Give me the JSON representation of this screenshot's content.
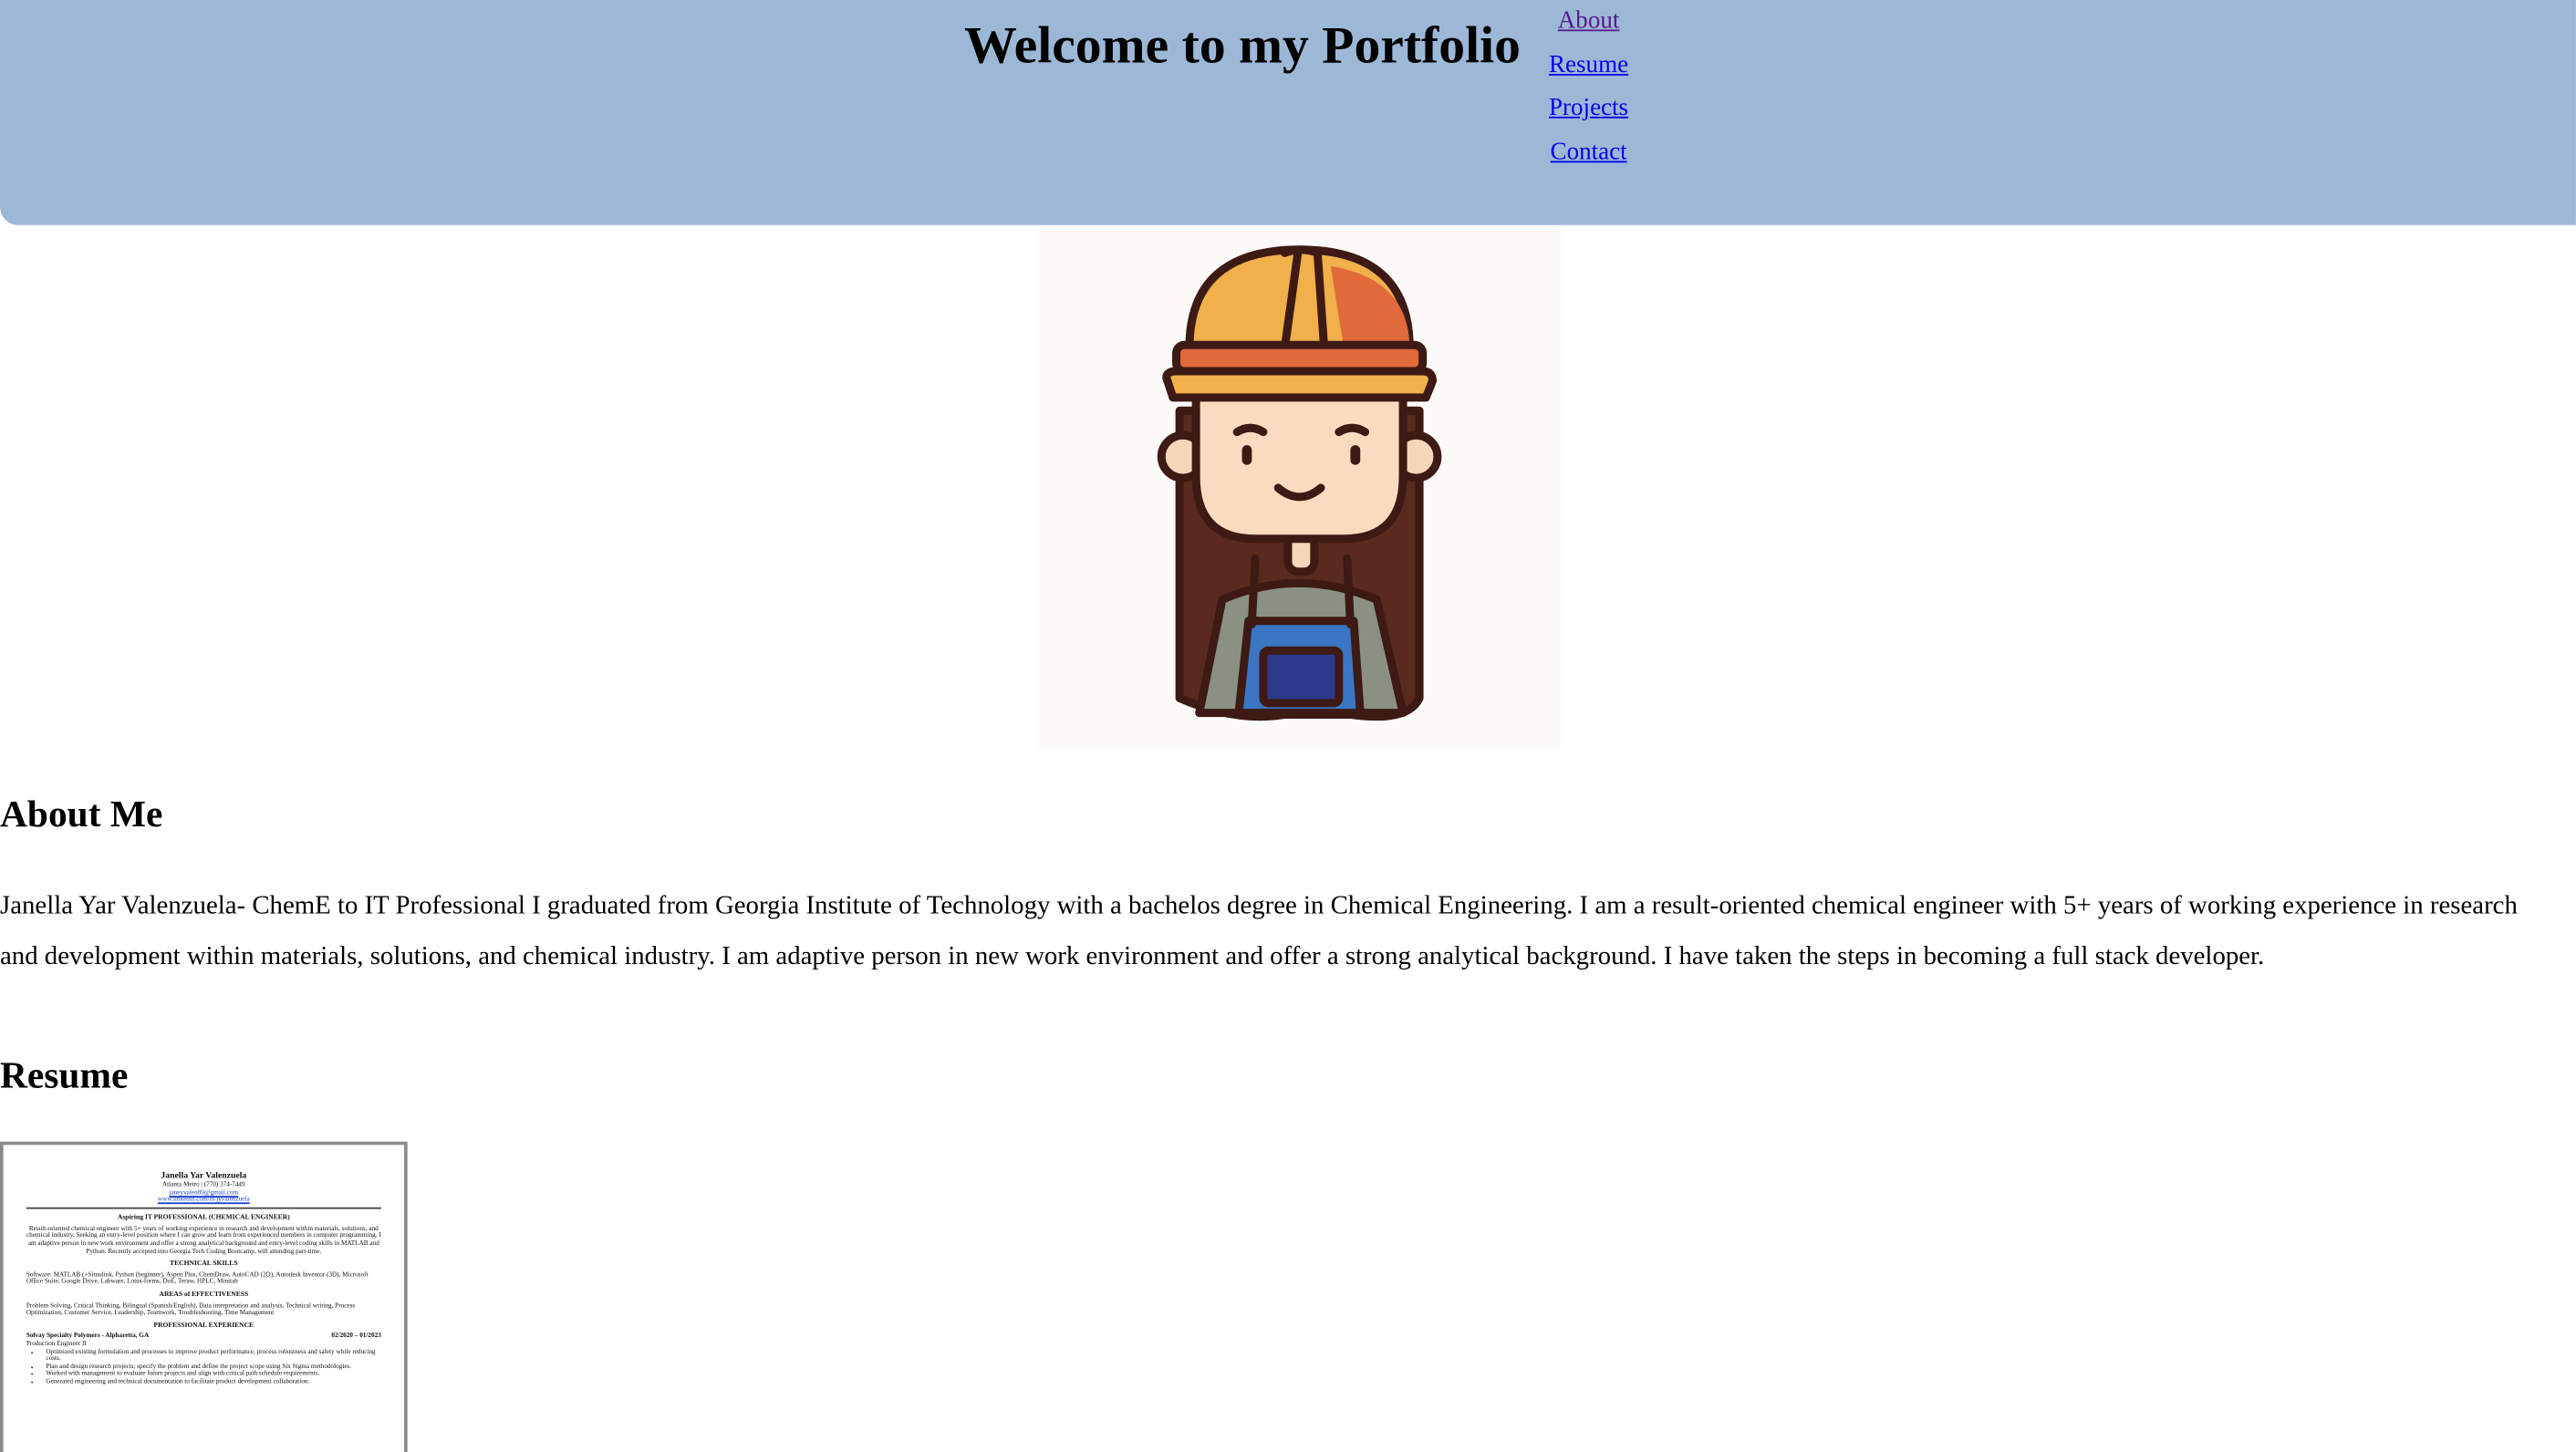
{
  "header": {
    "title": "Welcome to my Portfolio",
    "background": "#9db8d7",
    "nav": [
      {
        "label": "About",
        "visited": true
      },
      {
        "label": "Resume",
        "visited": false
      },
      {
        "label": "Projects",
        "visited": false
      },
      {
        "label": "Contact",
        "visited": false
      }
    ]
  },
  "avatar": {
    "icon": "engineer-avatar-icon"
  },
  "about": {
    "heading": "About Me",
    "text": "Janella Yar Valenzuela- ChemE to IT Professional I graduated from Georgia Institute of Technology with a bachelos degree in Chemical Engineering. I am a result-oriented chemical engineer with 5+ years of working experience in research and development within materials, solutions, and chemical industry. I am adaptive person in new work environment and offer a strong analytical background. I have taken the steps in becoming a full stack developer."
  },
  "resume": {
    "heading": "Resume",
    "document": {
      "name": "Janella Yar Valenzuela",
      "contact": "Atlanta Metro | (770) 374-7449",
      "email": "janeyvalen89@gmail.com",
      "linkedin": "www.linkedin.com/in/jyvalenzuela",
      "headline": "Aspiring IT PROFESSIONAL (CHEMICAL ENGINEER)",
      "summary": "Result-oriented chemical engineer with 5+ years of working experience in research and development within materials, solutions, and chemical industry. Seeking an entry-level position where I can grow and learn from experienced members in computer programming. I am adaptive person in new work environment and offer a strong analytical background and entry-level coding skills in MATLAB and Python. Recently accepted into Georgia Tech Coding Bootcamp, will attending part-time.",
      "skills_heading": "TECHNICAL SKILLS",
      "skills_text": "Software: MATLAB (+Simulink, Python (beginner), Aspen Plus, ChemDraw, AutoCAD (2D), Autodesk Inventor (3D), Microsoft Office Suite, Google Drive, Labware, Lotus-forms, DoE, Teraw, HPLC, Minitab",
      "areas_heading": "AREAS of EFFECTIVENESS",
      "areas_text": "Problem Solving, Critical Thinking, Bilingual (Spanish/English), Data interpretation and analysis, Technical writing, Process Optimization, Customer Service, Leadership, Teamwork, Troubleshooting, Time Management",
      "experience_heading": "PROFESSIONAL EXPERIENCE",
      "job_company": "Solvay Specialty Polymers - Alpharetta, GA",
      "job_dates": "02/2020 – 01/2023",
      "job_title": "Production Engineer II",
      "bullets": [
        "Optimized existing formulation and processes to improve product performance, process robustness and safety while reducing costs.",
        "Plan and design research projects; specify the problem and define the project scope using Six Sigma methodologies.",
        "Worked with management to evaluate future projects and align with critical path schedule requirements.",
        "Generated engineering and technical documentation to facilitate product development collaboration."
      ]
    }
  }
}
